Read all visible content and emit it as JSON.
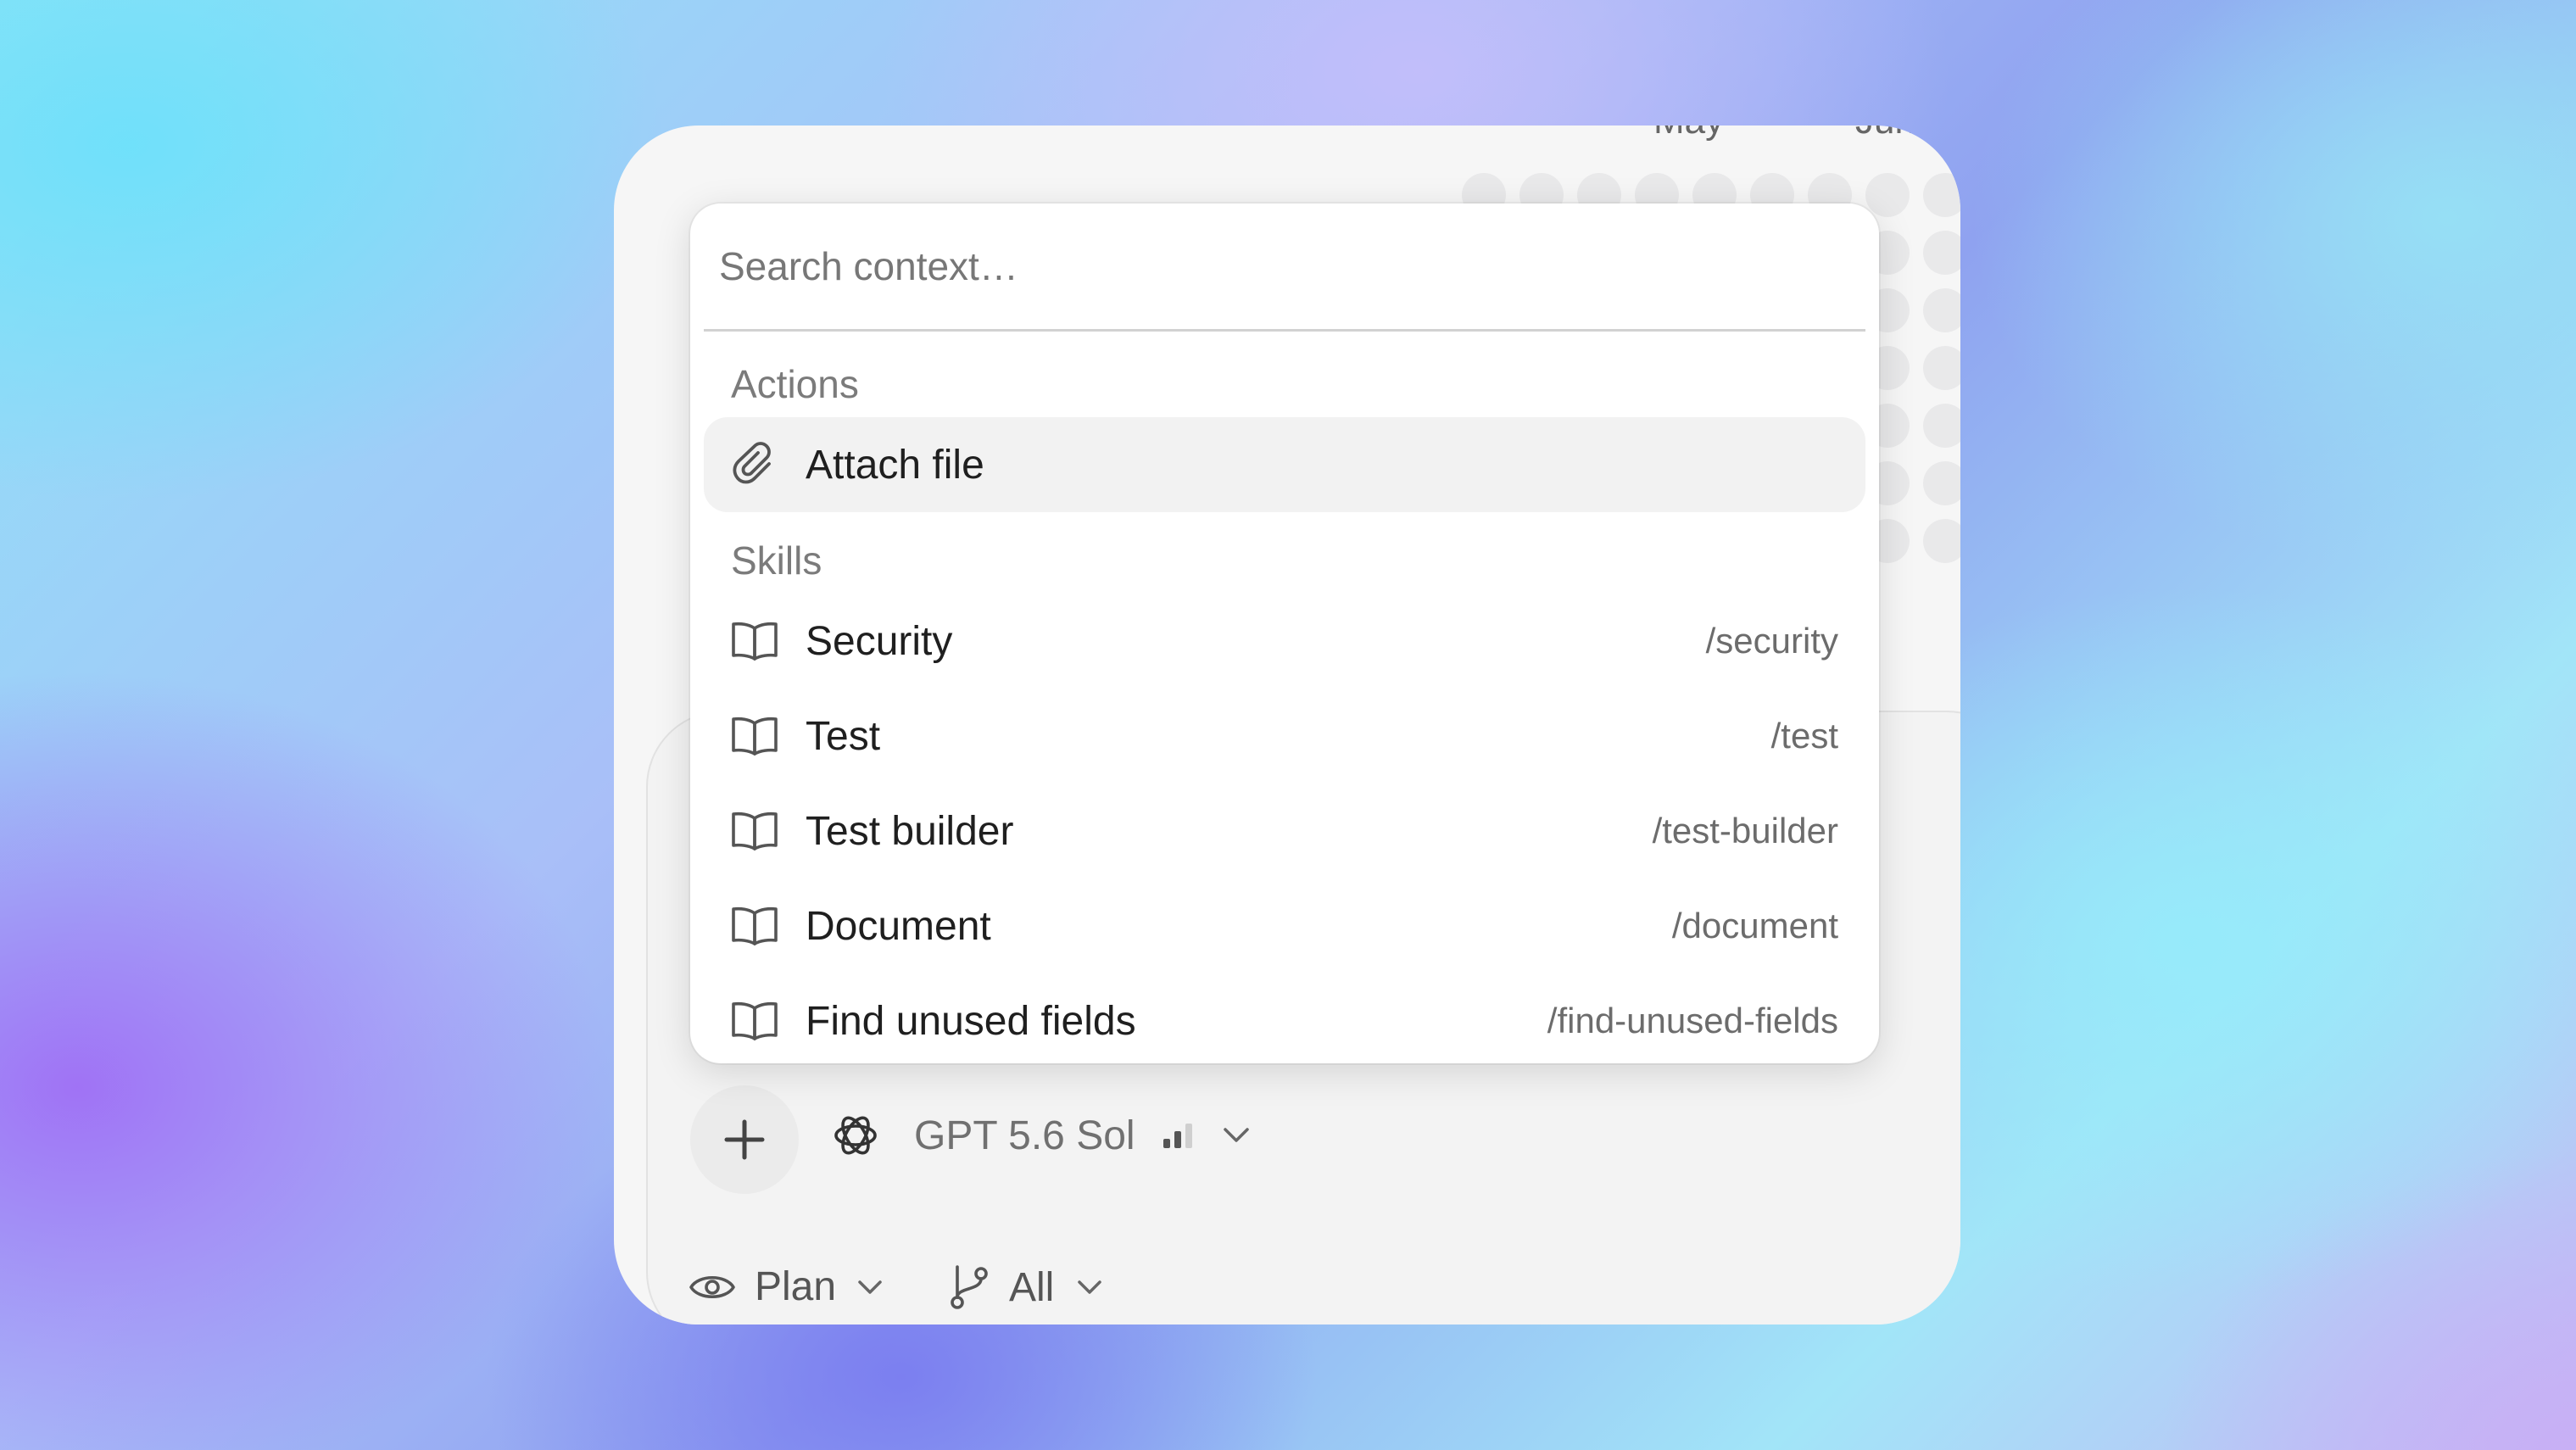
{
  "background_calendar": {
    "months": [
      "May",
      "Jun"
    ]
  },
  "context_menu": {
    "search": {
      "placeholder": "Search context…"
    },
    "sections": {
      "actions": {
        "label": "Actions",
        "items": [
          {
            "label": "Attach file",
            "icon": "paperclip-icon"
          }
        ]
      },
      "skills": {
        "label": "Skills",
        "items": [
          {
            "label": "Security",
            "command": "/security",
            "icon": "book-icon"
          },
          {
            "label": "Test",
            "command": "/test",
            "icon": "book-icon"
          },
          {
            "label": "Test builder",
            "command": "/test-builder",
            "icon": "book-icon"
          },
          {
            "label": "Document",
            "command": "/document",
            "icon": "book-icon"
          },
          {
            "label": "Find unused fields",
            "command": "/find-unused-fields",
            "icon": "book-icon"
          }
        ]
      }
    }
  },
  "composer": {
    "add_button_icon": "plus-icon",
    "model": {
      "name": "GPT 5.6 Sol",
      "icon": "openai-logo-icon",
      "level_icon": "signal-bars-icon"
    }
  },
  "bottom_bar": {
    "mode": {
      "label": "Plan",
      "icon": "eye-icon"
    },
    "branch": {
      "label": "All",
      "icon": "git-branch-icon"
    }
  }
}
